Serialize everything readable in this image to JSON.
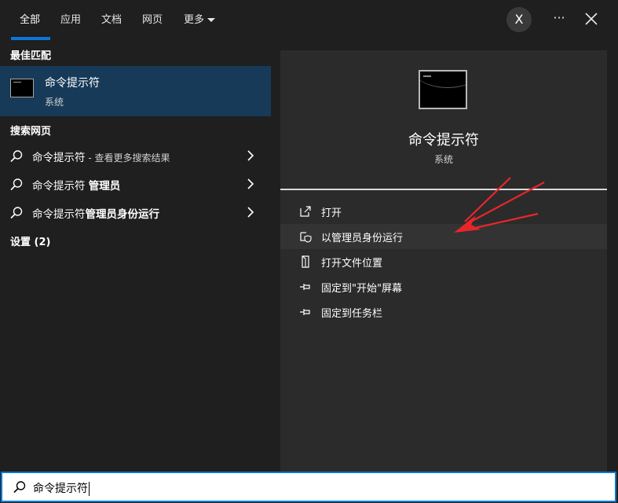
{
  "tabs": [
    {
      "label": "全部",
      "active": true
    },
    {
      "label": "应用",
      "active": false
    },
    {
      "label": "文档",
      "active": false
    },
    {
      "label": "网页",
      "active": false
    },
    {
      "label": "更多",
      "active": false
    }
  ],
  "header": {
    "avatar_letter": "X",
    "more_label": "···",
    "accent_color": "#0a78d4"
  },
  "left": {
    "best_match_heading": "最佳匹配",
    "best_match": {
      "title": "命令提示符",
      "subtitle": "系统",
      "icon": "cmd-icon"
    },
    "web_heading": "搜索网页",
    "web_results": [
      {
        "main": "命令提示符",
        "suffix": " - 查看更多搜索结果"
      },
      {
        "main": "命令提示符 ",
        "bold": "管理员"
      },
      {
        "main": "命令提示符",
        "bold": "管理员身份运行"
      }
    ],
    "settings_heading": "设置 (2)"
  },
  "detail": {
    "title": "命令提示符",
    "subtitle": "系统",
    "actions": [
      {
        "label": "打开",
        "icon": "open-icon"
      },
      {
        "label": "以管理员身份运行",
        "icon": "shield-icon"
      },
      {
        "label": "打开文件位置",
        "icon": "file-location-icon"
      },
      {
        "label": "固定到\"开始\"屏幕",
        "icon": "pin-icon"
      },
      {
        "label": "固定到任务栏",
        "icon": "pin-icon"
      }
    ]
  },
  "search": {
    "value": "命令提示符",
    "icon": "search-icon"
  },
  "annotation": {
    "arrow_color": "#e8262a"
  }
}
